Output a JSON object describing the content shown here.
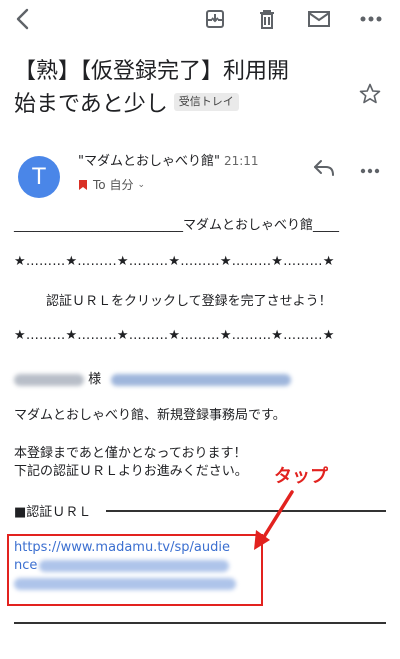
{
  "toolbar": {
    "back_icon": "back-arrow-icon",
    "archive_icon": "archive-icon",
    "delete_icon": "trash-icon",
    "mail_icon": "mail-icon",
    "more_icon": "more-horiz-icon"
  },
  "subject": {
    "line1": "【熟】【仮登録完了】利用開",
    "line2": "始まであと少し",
    "label": "受信トレイ"
  },
  "message": {
    "avatar_letter": "T",
    "sender": "\"マダムとおしゃべり館\"",
    "time": "21:11",
    "recipient": "To 自分",
    "avatar_color": "#4a86e8"
  },
  "body": {
    "header_line": "__________________________マダムとおしゃべり館____",
    "stars_line1": "★………★………★………★………★………★………★",
    "instruction": "認証ＵＲＬをクリックして登録を完了させよう！",
    "stars_line2": "★………★………★………★………★………★………★",
    "sama": "様",
    "intro": "マダムとおしゃべり館、新規登録事務局です。",
    "note1": "本登録まであと僅かとなっております！",
    "note2": "下記の認証ＵＲＬよりお進みください。",
    "url_label": "■認証ＵＲＬ",
    "url_line1": "https://www.madamu.tv/sp/audie",
    "url_line2_start": "nce"
  },
  "annotation": {
    "tap_label": "タップ",
    "color": "#e2221f"
  }
}
